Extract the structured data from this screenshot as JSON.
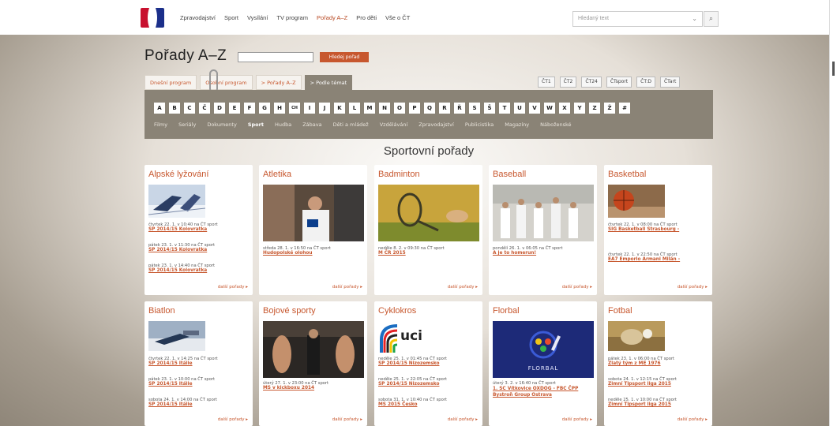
{
  "nav": {
    "items": [
      "Zpravodajství",
      "Sport",
      "Vysílání",
      "TV program",
      "Pořady A–Z",
      "Pro děti",
      "Vše o ČT"
    ],
    "active_index": 4
  },
  "search": {
    "placeholder": "Hledaný text"
  },
  "page": {
    "title": "Pořady A–Z",
    "search_button": "Hledej pořad"
  },
  "tabs": [
    "Dnešní program",
    "Osobní program",
    "> Pořady A–Z",
    "> Podle témat"
  ],
  "channels": [
    "ČT1",
    "ČT2",
    "ČT24",
    "ČTsport",
    "ČT:D",
    "ČTart"
  ],
  "letters": [
    "A",
    "B",
    "C",
    "Č",
    "D",
    "E",
    "F",
    "G",
    "H",
    "CH",
    "I",
    "J",
    "K",
    "L",
    "M",
    "N",
    "O",
    "P",
    "Q",
    "R",
    "Ř",
    "S",
    "Š",
    "T",
    "U",
    "V",
    "W",
    "X",
    "Y",
    "Z",
    "Ž",
    "#"
  ],
  "genres": [
    "Filmy",
    "Seriály",
    "Dokumenty",
    "Sport",
    "Hudba",
    "Zábava",
    "Děti a mládež",
    "Vzdělávání",
    "Zpravodajství",
    "Publicistika",
    "Magazíny",
    "Náboženské"
  ],
  "section_title": "Sportovní pořady",
  "more_label": "další pořady ▸",
  "cards": [
    {
      "title": "Alpské lyžování",
      "entries": [
        {
          "meta": "čtvrtek 22. 1. v 10:40 na ČT sport",
          "prog": "SP 2014/15 Kolovratka"
        },
        {
          "meta": "pátek 23. 1. v 11:30 na ČT sport",
          "prog": "SP 2014/15 Kolovratka"
        },
        {
          "meta": "pátek 23. 1. v 14:40 na ČT sport",
          "prog": "SP 2014/15 Kolovratka"
        }
      ]
    },
    {
      "title": "Atletika",
      "entries": [
        {
          "meta": "středa 28. 1. v 16:50 na ČT sport",
          "prog": "Hudopolské olohou"
        }
      ]
    },
    {
      "title": "Badminton",
      "entries": [
        {
          "meta": "neděle 8. 2. v 09:30 na ČT sport",
          "prog": "M ČR 2015"
        }
      ]
    },
    {
      "title": "Baseball",
      "entries": [
        {
          "meta": "pondělí 26. 1. v 06:05 na ČT sport",
          "prog": "A je to homerun!"
        }
      ]
    },
    {
      "title": "Basketbal",
      "entries": [
        {
          "meta": "čtvrtek 22. 1. v 08:00 na ČT sport",
          "prog": "SIG Basketball Strasbourg -"
        },
        {
          "meta": "čtvrtek 22. 1. v 22:50 na ČT sport",
          "prog": "EA7 Emporio Armani Milán -"
        }
      ]
    },
    {
      "title": "Biatlon",
      "entries": [
        {
          "meta": "čtvrtek 22. 1. v 14:25 na ČT sport",
          "prog": "SP 2014/15 Itálie"
        },
        {
          "meta": "pátek 23. 1. v 10:00 na ČT sport",
          "prog": "SP 2014/15 Itálie"
        },
        {
          "meta": "sobota 24. 1. v 14:00 na ČT sport",
          "prog": "SP 2014/15 Itálie"
        }
      ]
    },
    {
      "title": "Bojové sporty",
      "entries": [
        {
          "meta": "úterý 27. 1. v 23:00 na ČT sport",
          "prog": "MS v kickboxu 2014"
        }
      ]
    },
    {
      "title": "Cyklokros",
      "entries": [
        {
          "meta": "neděle 25. 1. v 01:45 na ČT sport",
          "prog": "SP 2014/15 Nizozemsko"
        },
        {
          "meta": "neděle 25. 1. v 22:05 na ČT sport",
          "prog": "SP 2014/15 Nizozemsko"
        },
        {
          "meta": "sobota 31. 1. v 10:40 na ČT sport",
          "prog": "MS 2015 Česko"
        }
      ]
    },
    {
      "title": "Florbal",
      "entries": [
        {
          "meta": "úterý 3. 2. v 16:40 na ČT sport",
          "prog": "1. SC Vítkovice OXDOG - FBC ČPP Bystroň Group Ostrava"
        }
      ]
    },
    {
      "title": "Fotbal",
      "entries": [
        {
          "meta": "pátek 23. 1. v 06:00 na ČT sport",
          "prog": "Zlatý tým z ME 1976"
        },
        {
          "meta": "sobota 24. 1. v 12:15 na ČT sport",
          "prog": "Zimní Tipsport liga 2015"
        },
        {
          "meta": "neděle 25. 1. v 10:00 na ČT sport",
          "prog": "Zimní Tipsport liga 2015"
        }
      ]
    }
  ]
}
